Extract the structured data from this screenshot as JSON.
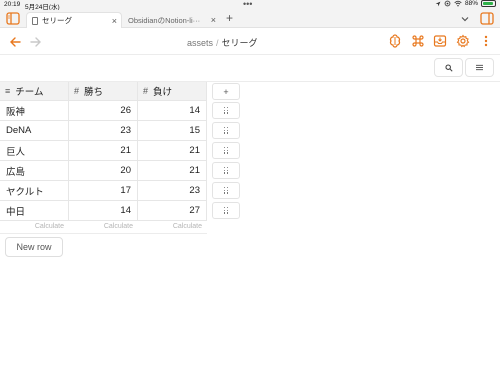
{
  "status": {
    "time": "20:19",
    "date": "5月24日(水)",
    "dots": "•••",
    "battery_text": "88%",
    "battery_level": 0.88
  },
  "tabs": [
    {
      "label": "セリーグ",
      "active": true
    },
    {
      "label": "ObsidianのNotion-li···",
      "active": false
    }
  ],
  "new_tab_label": "+",
  "breadcrumb": {
    "folder": "assets",
    "separator": "/",
    "current": "セリーグ"
  },
  "colors": {
    "accent": "#e8781e",
    "header_bg": "#f2f2f2",
    "battery": "#2fb24a"
  },
  "table": {
    "columns": [
      {
        "type_icon": "≡",
        "name": "チーム"
      },
      {
        "type_icon": "#",
        "name": "勝ち"
      },
      {
        "type_icon": "#",
        "name": "負け"
      }
    ],
    "rows": [
      {
        "team": "阪神",
        "wins": "26",
        "losses": "14"
      },
      {
        "team": "DeNA",
        "wins": "23",
        "losses": "15"
      },
      {
        "team": "巨人",
        "wins": "21",
        "losses": "21"
      },
      {
        "team": "広島",
        "wins": "20",
        "losses": "21"
      },
      {
        "team": "ヤクルト",
        "wins": "17",
        "losses": "23"
      },
      {
        "team": "中日",
        "wins": "14",
        "losses": "27"
      }
    ],
    "calculate_label": "Calculate",
    "add_column_label": "+",
    "new_row_label": "New row"
  }
}
